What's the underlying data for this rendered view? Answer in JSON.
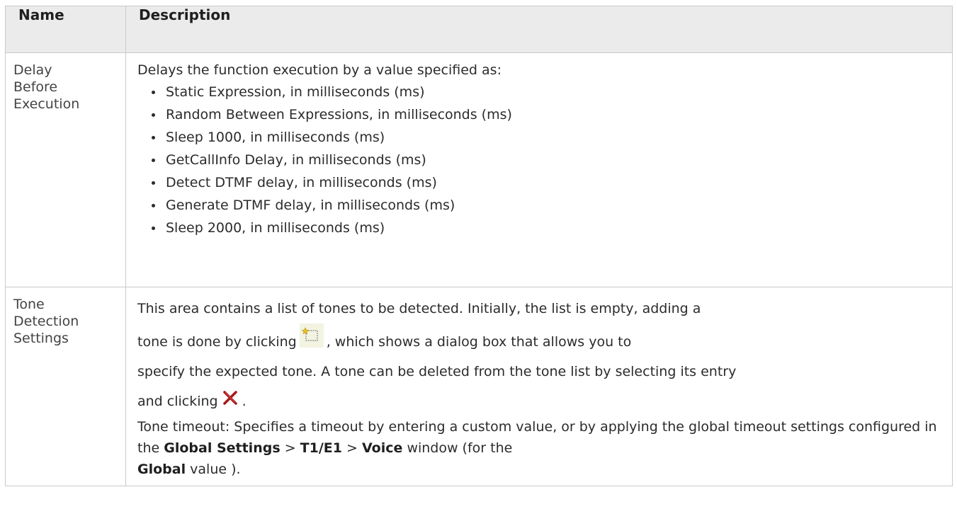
{
  "table": {
    "headers": {
      "name": "Name",
      "description": "Description"
    },
    "rows": [
      {
        "name": [
          "Delay",
          "Before",
          "Execution"
        ],
        "intro": "Delays the function execution by a value specified as:",
        "options": [
          "Static Expression, in milliseconds (ms)",
          "Random Between Expressions, in milliseconds (ms)",
          "Sleep 1000, in milliseconds (ms)",
          "GetCallInfo Delay, in milliseconds (ms)",
          "Detect DTMF delay, in milliseconds (ms)",
          "Generate DTMF delay, in milliseconds (ms)",
          "Sleep 2000, in milliseconds (ms)"
        ]
      },
      {
        "name": [
          "Tone",
          "Detection",
          "Settings"
        ],
        "p1_line1": "This area contains a list of tones to be detected. Initially, the list is empty, adding a",
        "p1_before_icon": "tone is done by clicking",
        "p1_after_icon": ", which shows a dialog box that allows you to",
        "p1_line3": "specify the expected tone. A tone can be deleted from the tone list by selecting its entry",
        "p1_before_delete": "and clicking",
        "p1_end": ".",
        "p2_start": "Tone timeout: Specifies a timeout by entering a custom value, or by applying the global timeout settings configured in the",
        "p2_global_settings": "Global Settings",
        "p2_sep1": ">",
        "p2_t1e1": "T1/E1",
        "p2_sep2": ">",
        "p2_voice": "Voice",
        "p2_window": "window (for the",
        "p2_global": "Global",
        "p2_end": "value )."
      }
    ]
  },
  "icons": {
    "new_tone": "new-item-icon",
    "delete_tone": "delete-x-icon",
    "delete_color": "#a01818"
  }
}
